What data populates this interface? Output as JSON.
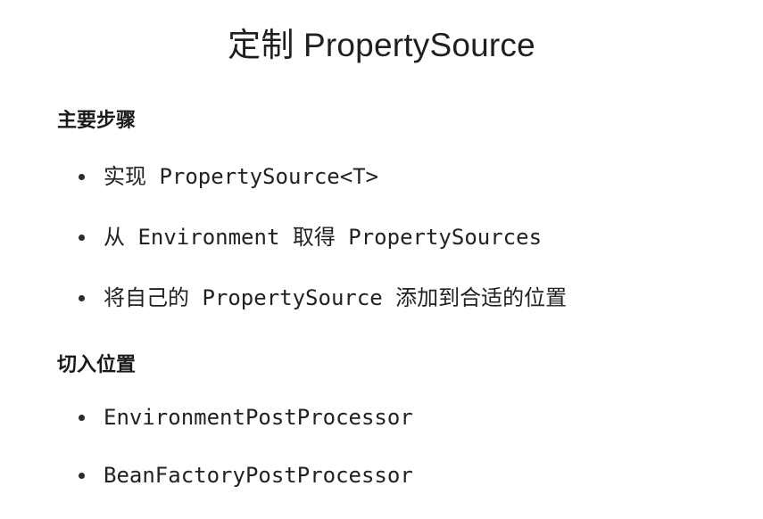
{
  "slide": {
    "title": "定制 PropertySource",
    "sections": [
      {
        "heading": "主要步骤",
        "bullets": [
          "实现 PropertySource<T>",
          "从 Environment 取得 PropertySources",
          "将自己的 PropertySource 添加到合适的位置"
        ]
      },
      {
        "heading": "切入位置",
        "bullets": [
          "EnvironmentPostProcessor",
          "BeanFactoryPostProcessor"
        ]
      }
    ]
  }
}
